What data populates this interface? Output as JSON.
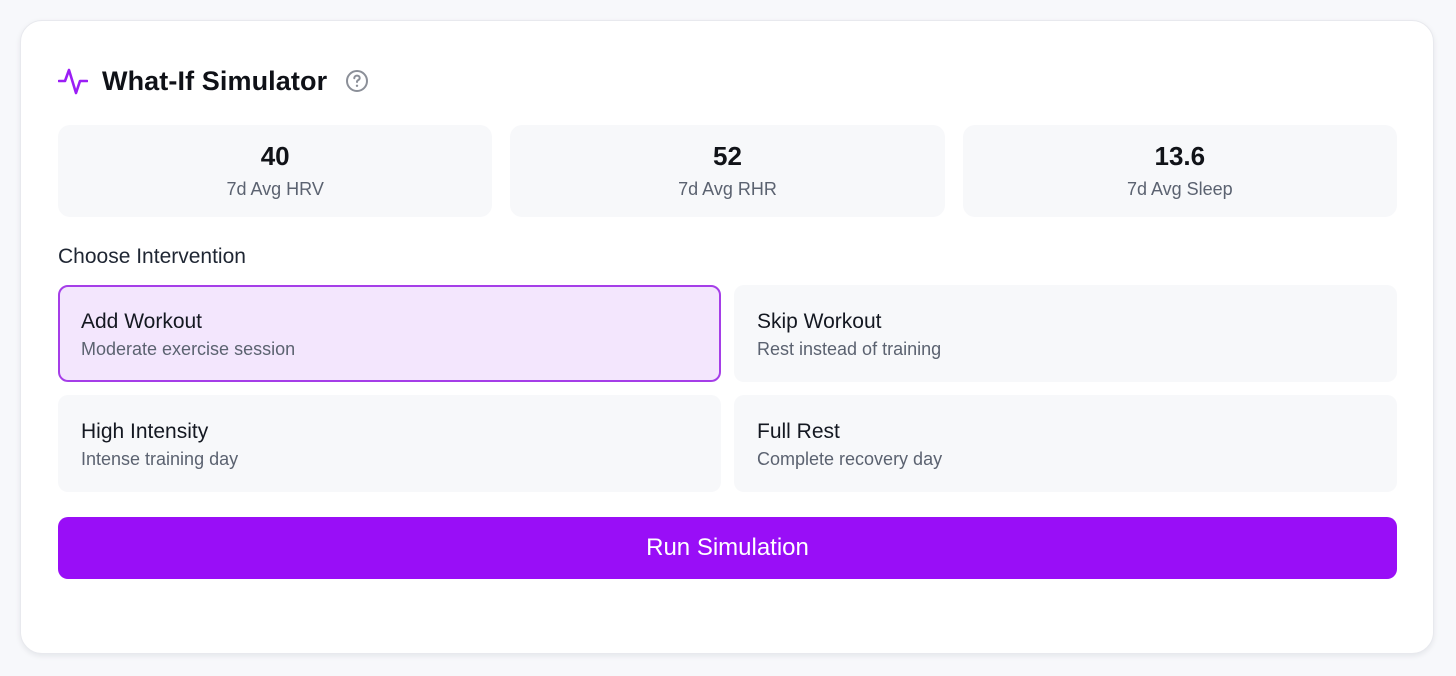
{
  "header": {
    "title": "What-If Simulator",
    "icon": "activity-pulse-icon",
    "help_icon": "question-circle-icon",
    "accent_color": "#9b1ef5"
  },
  "metrics": [
    {
      "value": "40",
      "label": "7d Avg HRV"
    },
    {
      "value": "52",
      "label": "7d Avg RHR"
    },
    {
      "value": "13.6",
      "label": "7d Avg Sleep"
    }
  ],
  "intervention": {
    "label": "Choose Intervention",
    "selected_index": 0,
    "options": [
      {
        "title": "Add Workout",
        "description": "Moderate exercise session"
      },
      {
        "title": "Skip Workout",
        "description": "Rest instead of training"
      },
      {
        "title": "High Intensity",
        "description": "Intense training day"
      },
      {
        "title": "Full Rest",
        "description": "Complete recovery day"
      }
    ]
  },
  "actions": {
    "run_label": "Run Simulation",
    "run_color": "#990ef7"
  }
}
